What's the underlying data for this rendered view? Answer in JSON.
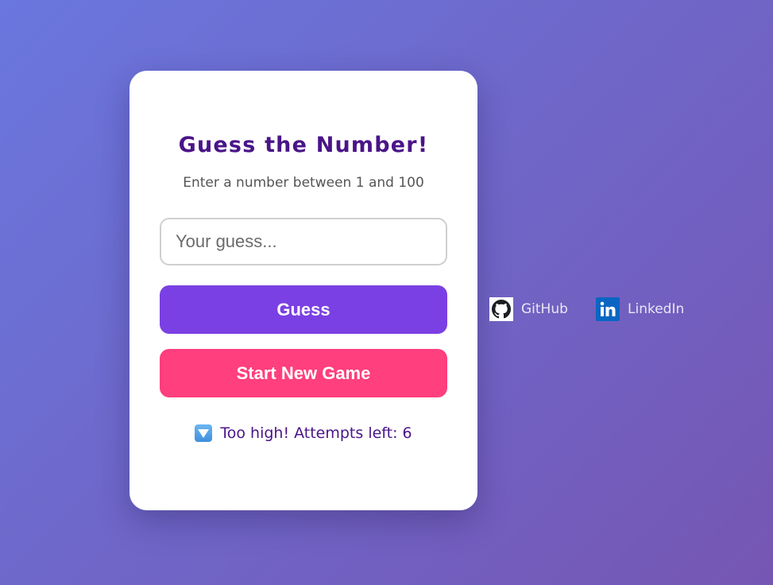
{
  "game": {
    "title": "Guess the Number!",
    "subtitle": "Enter a number between 1 and 100",
    "input": {
      "placeholder": "Your guess...",
      "value": ""
    },
    "guess_button_label": "Guess",
    "new_game_button_label": "Start New Game",
    "feedback": {
      "icon": "down-arrow-icon",
      "text": "Too high! Attempts left: 6"
    }
  },
  "links": [
    {
      "label": "GitHub",
      "icon": "github-icon"
    },
    {
      "label": "LinkedIn",
      "icon": "linkedin-icon"
    }
  ],
  "colors": {
    "title": "#4a1488",
    "guess_button": "#7b40e3",
    "new_game_button": "#ff3f7e",
    "linkedin_brand": "#0a66c2"
  }
}
